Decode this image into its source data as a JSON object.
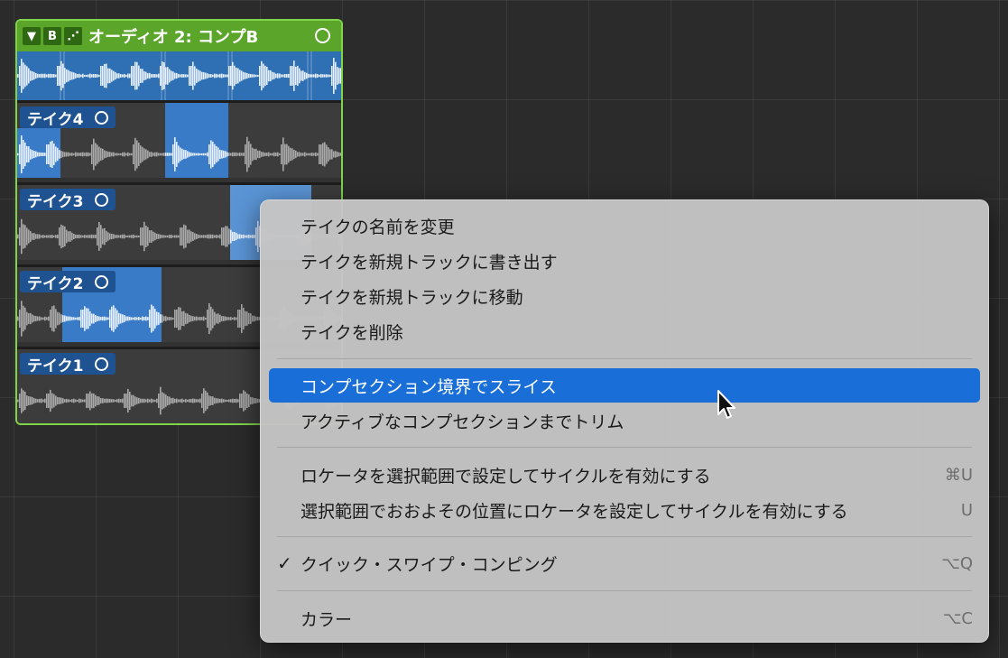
{
  "take_folder": {
    "header": {
      "disclosure_glyph": "▼",
      "b_label": "B",
      "flex_glyph": "⋰",
      "title": "オーディオ 2: コンプB",
      "colors": {
        "header": "#5aa52a",
        "border": "#7fd44a"
      }
    },
    "takes": [
      {
        "label": "テイク4"
      },
      {
        "label": "テイク3"
      },
      {
        "label": "テイク2"
      },
      {
        "label": "テイク1"
      }
    ]
  },
  "context_menu": {
    "items": [
      {
        "label": "テイクの名前を変更",
        "shortcut": ""
      },
      {
        "label": "テイクを新規トラックに書き出す",
        "shortcut": ""
      },
      {
        "label": "テイクを新規トラックに移動",
        "shortcut": ""
      },
      {
        "label": "テイクを削除",
        "shortcut": ""
      },
      {
        "label": "コンプセクション境界でスライス",
        "shortcut": "",
        "highlighted": true
      },
      {
        "label": "アクティブなコンプセクションまでトリム",
        "shortcut": ""
      },
      {
        "label": "ロケータを選択範囲で設定してサイクルを有効にする",
        "shortcut": "⌘U"
      },
      {
        "label": "選択範囲でおおよその位置にロケータを設定してサイクルを有効にする",
        "shortcut": "U"
      },
      {
        "label": "クイック・スワイプ・コンピング",
        "shortcut": "⌥Q",
        "checked": true,
        "check_glyph": "✓"
      },
      {
        "label": "カラー",
        "shortcut": "⌥C"
      }
    ],
    "highlight_color": "#1a6ed8"
  }
}
